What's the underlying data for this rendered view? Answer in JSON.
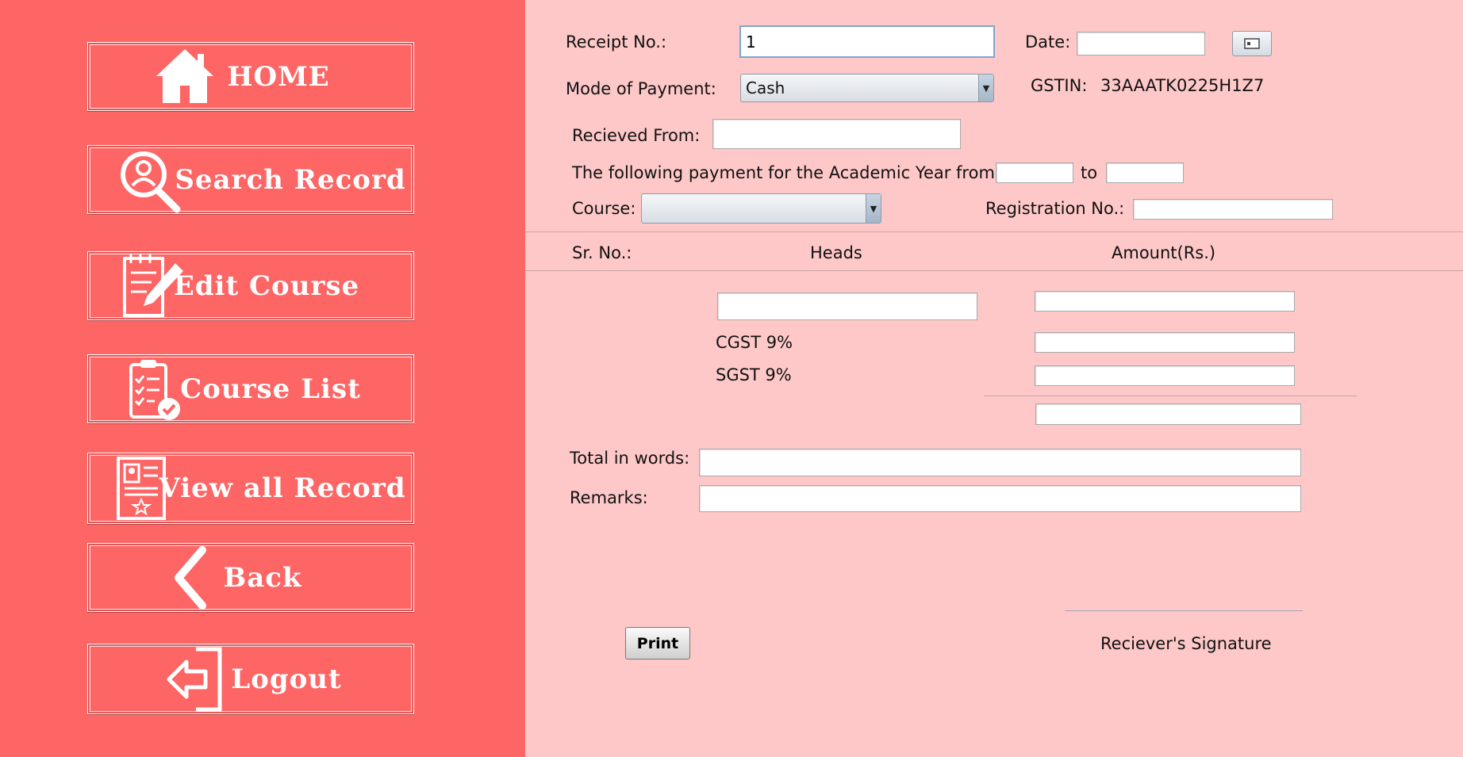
{
  "sidebar": {
    "buttons": [
      {
        "label": "HOME",
        "icon": "home-icon"
      },
      {
        "label": "Search Record",
        "icon": "search-person-icon"
      },
      {
        "label": "Edit Course",
        "icon": "edit-notepad-icon"
      },
      {
        "label": "Course List",
        "icon": "checklist-clipboard-icon"
      },
      {
        "label": "View all Record",
        "icon": "id-card-icon"
      },
      {
        "label": "Back",
        "icon": "chevron-left-icon"
      },
      {
        "label": "Logout",
        "icon": "logout-icon"
      }
    ]
  },
  "form": {
    "receipt_label": "Receipt No.:",
    "receipt_value": "1",
    "date_label": "Date:",
    "date_value": "",
    "mode_label": "Mode of Payment:",
    "mode_value": "Cash",
    "gstin_label": "GSTIN:",
    "gstin_value": "33AAATK0225H1Z7",
    "received_label": "Recieved From:",
    "received_value": "",
    "academic_label": "The following payment for the Academic Year from",
    "academic_from": "",
    "to_label": "to",
    "academic_to": "",
    "course_label": "Course:",
    "course_value": "",
    "registration_label": "Registration No.:",
    "registration_value": ""
  },
  "table": {
    "headers": {
      "sr": "Sr. No.:",
      "heads": "Heads",
      "amount": "Amount(Rs.)"
    },
    "cgst_label": "CGST 9%",
    "sgst_label": "SGST 9%"
  },
  "footer": {
    "total_words_label": "Total in words:",
    "remarks_label": "Remarks:",
    "print_label": "Print",
    "signature_label": "Reciever's Signature"
  },
  "colors": {
    "sidebar_bg": "#fe6565",
    "main_bg": "#fec8c8"
  }
}
